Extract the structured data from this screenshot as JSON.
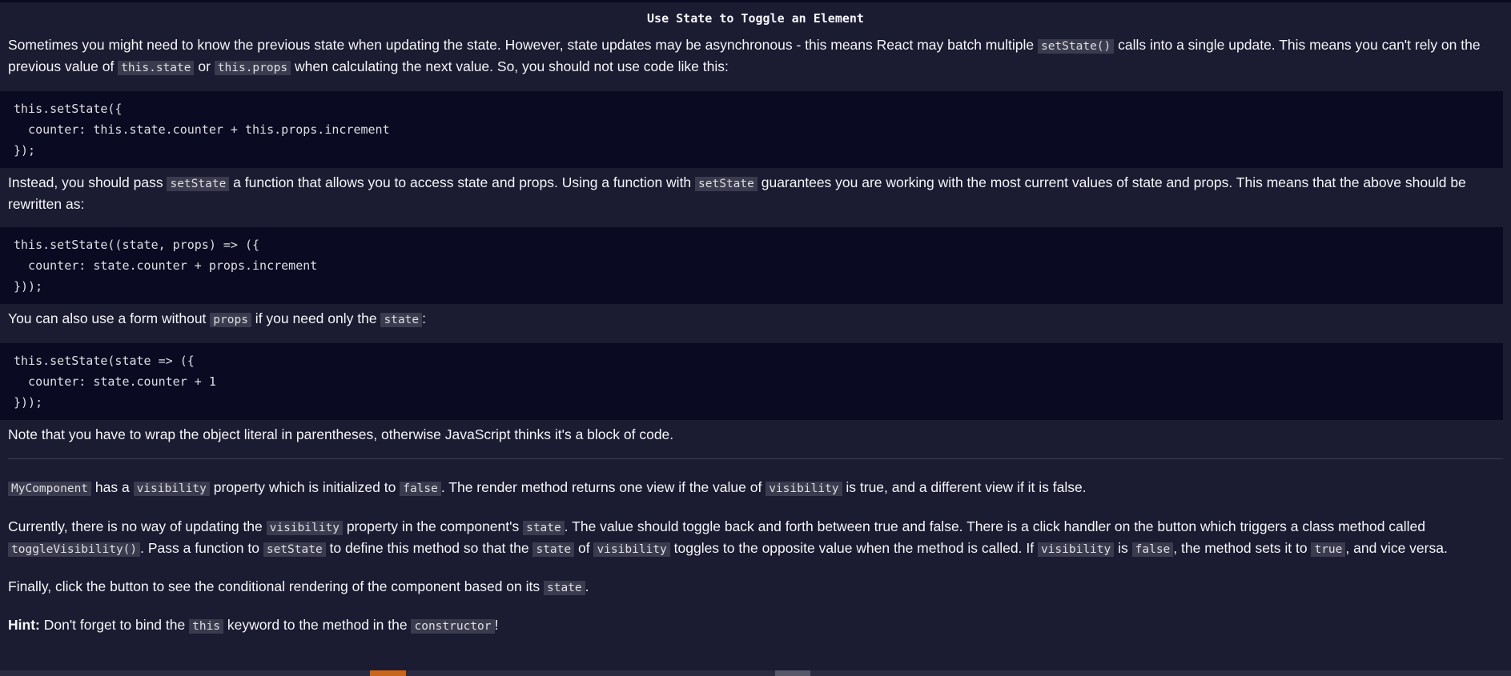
{
  "title": "Use State to Toggle an Element",
  "p1": {
    "t1": "Sometimes you might need to know the previous state when updating the state. However, state updates may be asynchronous - this means React may batch multiple ",
    "c1": "setState()",
    "t2": " calls into a single update. This means you can't rely on the previous value of ",
    "c2": "this.state",
    "t3": " or ",
    "c3": "this.props",
    "t4": " when calculating the next value. So, you should not use code like this:"
  },
  "code1": [
    "this.setState({",
    "  counter: this.state.counter + this.props.increment",
    "});"
  ],
  "p2": {
    "t1": "Instead, you should pass ",
    "c1": "setState",
    "t2": " a function that allows you to access state and props. Using a function with ",
    "c2": "setState",
    "t3": " guarantees you are working with the most current values of state and props. This means that the above should be rewritten as:"
  },
  "code2": [
    "this.setState((state, props) => ({",
    "  counter: state.counter + props.increment",
    "}));"
  ],
  "p3": {
    "t1": "You can also use a form without ",
    "c1": "props",
    "t2": " if you need only the ",
    "c2": "state",
    "t3": ":"
  },
  "code3": [
    "this.setState(state => ({",
    "  counter: state.counter + 1",
    "}));"
  ],
  "p4": {
    "t1": "Note that you have to wrap the object literal in parentheses, otherwise JavaScript thinks it's a block of code."
  },
  "p5": {
    "c1": "MyComponent",
    "t1": " has a ",
    "c2": "visibility",
    "t2": " property which is initialized to ",
    "c3": "false",
    "t3": ". The render method returns one view if the value of ",
    "c4": "visibility",
    "t4": " is true, and a different view if it is false."
  },
  "p6": {
    "t1": "Currently, there is no way of updating the ",
    "c1": "visibility",
    "t2": " property in the component's ",
    "c2": "state",
    "t3": ". The value should toggle back and forth between true and false. There is a click handler on the button which triggers a class method called ",
    "c3": "toggleVisibility()",
    "t4": ". Pass a function to ",
    "c4": "setState",
    "t5": " to define this method so that the ",
    "c5": "state",
    "t6": " of ",
    "c6": "visibility",
    "t7": " toggles to the opposite value when the method is called. If ",
    "c7": "visibility",
    "t8": " is ",
    "c8": "false",
    "t9": ", the method sets it to ",
    "c9": "true",
    "t10": ", and vice versa."
  },
  "p7": {
    "t1": "Finally, click the button to see the conditional rendering of the component based on its ",
    "c1": "state",
    "t2": "."
  },
  "p8": {
    "label": "Hint:",
    "t1": " Don't forget to bind the ",
    "c1": "this",
    "t2": " keyword to the method in the ",
    "c2": "constructor",
    "t3": "!"
  },
  "colors": {
    "background": "#1b1b32",
    "code_block_bg": "#0a0a23",
    "inline_code_bg": "#3b3b4f",
    "text": "#f5f6f7",
    "accent_orange": "#c8661c"
  }
}
